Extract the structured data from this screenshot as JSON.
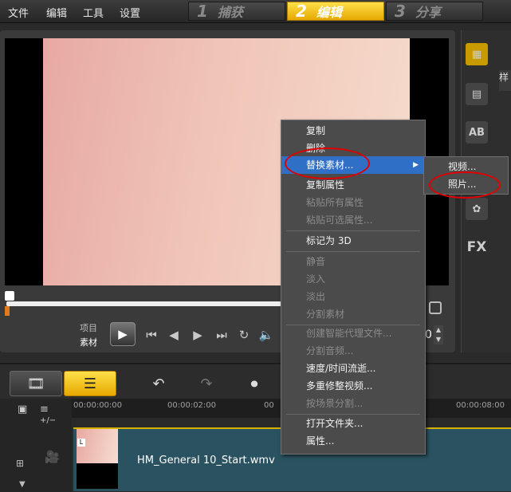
{
  "menu": [
    "文件",
    "编辑",
    "工具",
    "设置"
  ],
  "steps": [
    {
      "num": "1",
      "label": "捕获"
    },
    {
      "num": "2",
      "label": "编辑"
    },
    {
      "num": "3",
      "label": "分享"
    }
  ],
  "preview": {
    "mode_project": "项目",
    "mode_clip": "素材",
    "time_fragment": "0"
  },
  "library": {
    "panel_label": "样",
    "fx_label": "FX",
    "title_label": "AB"
  },
  "ruler": [
    "00:00:00:00",
    "00:00:02:00",
    "00",
    "00:00:08:00"
  ],
  "track": {
    "zoom_label": "+/−",
    "clip_name": "HM_General 10_Start.wmv",
    "clip_tag": "L"
  },
  "context_menu": [
    {
      "label": "复制",
      "enabled": true
    },
    {
      "label": "删除",
      "enabled": true
    },
    {
      "label": "替换素材...",
      "enabled": true,
      "submenu": true
    },
    {
      "label": "复制属性",
      "enabled": true
    },
    {
      "label": "粘贴所有属性",
      "enabled": false
    },
    {
      "label": "粘贴可选属性...",
      "enabled": false
    },
    {
      "label": "标记为 3D",
      "enabled": true
    },
    {
      "label": "静音",
      "enabled": false
    },
    {
      "label": "淡入",
      "enabled": false
    },
    {
      "label": "淡出",
      "enabled": false
    },
    {
      "label": "分割素材",
      "enabled": false
    },
    {
      "label": "创建智能代理文件...",
      "enabled": false
    },
    {
      "label": "分割音频...",
      "enabled": false
    },
    {
      "label": "速度/时间流逝...",
      "enabled": true
    },
    {
      "label": "多重修整视频...",
      "enabled": true
    },
    {
      "label": "按场景分割...",
      "enabled": false
    },
    {
      "label": "打开文件夹...",
      "enabled": true
    },
    {
      "label": "属性...",
      "enabled": true
    }
  ],
  "submenu": [
    {
      "label": "视频..."
    },
    {
      "label": "照片..."
    }
  ],
  "colors": {
    "highlight": "#2f6fc6",
    "annotation": "#e00000",
    "active_step": "#f5c400"
  }
}
